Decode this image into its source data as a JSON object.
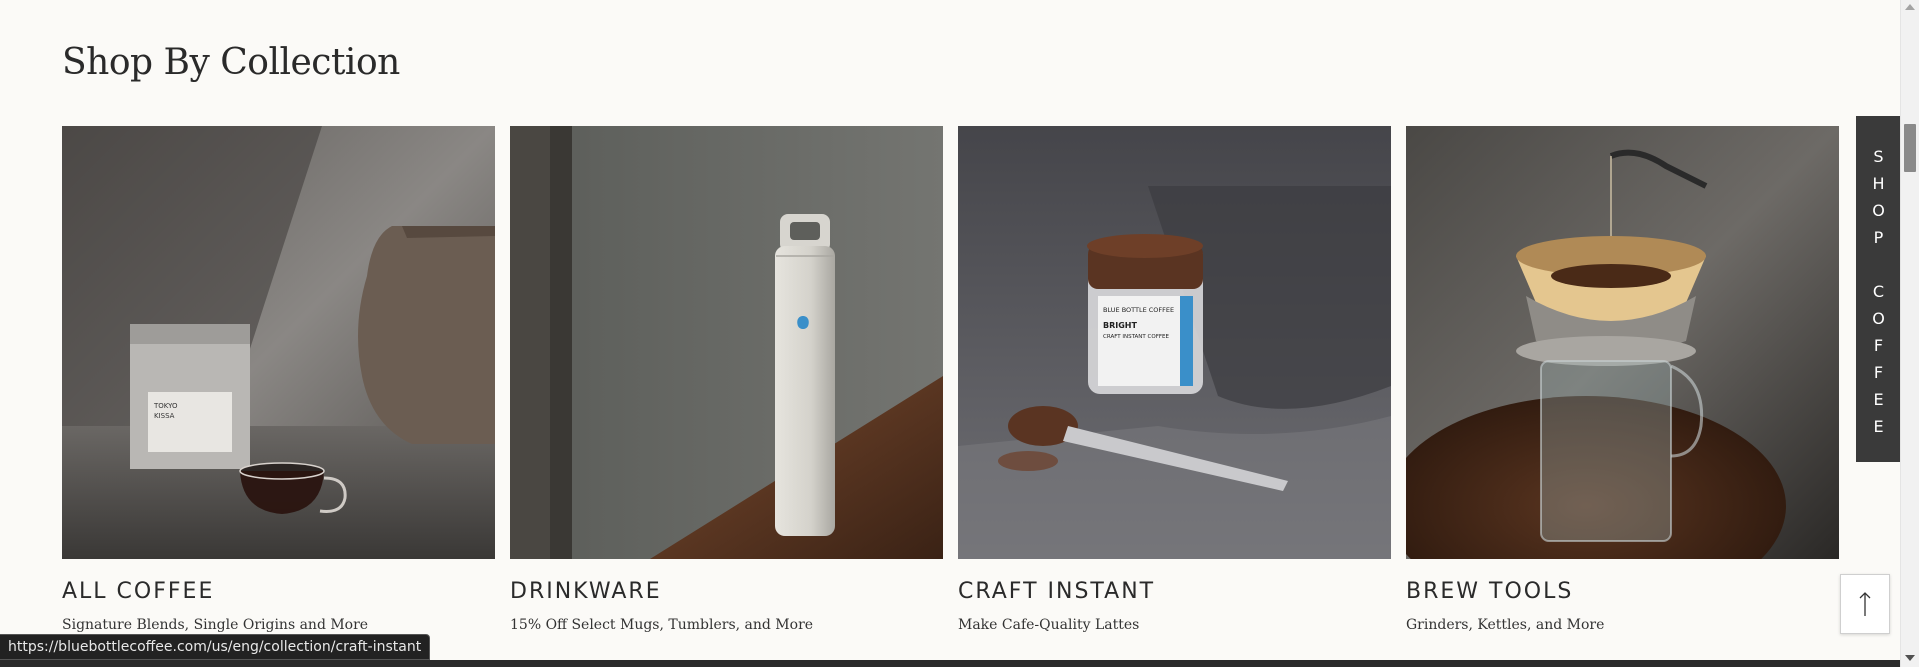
{
  "section": {
    "title": "Shop By Collection"
  },
  "collections": [
    {
      "title": "ALL COFFEE",
      "subtitle": "Signature Blends, Single Origins and More"
    },
    {
      "title": "DRINKWARE",
      "subtitle": "15% Off Select Mugs, Tumblers, and More"
    },
    {
      "title": "CRAFT INSTANT",
      "subtitle": "Make Cafe-Quality Lattes"
    },
    {
      "title": "BREW TOOLS",
      "subtitle": "Grinders, Kettles, and More"
    }
  ],
  "side_tab": {
    "letters": [
      "S",
      "H",
      "O",
      "P",
      "",
      "C",
      "O",
      "F",
      "F",
      "E",
      "E"
    ]
  },
  "scroll_top": {
    "icon": "arrow-up-icon"
  },
  "status_bar": {
    "url": "https://bluebottlecoffee.com/us/eng/collection/craft-instant"
  },
  "image_text": {
    "bag_line_1": "TOKYO",
    "bag_line_2": "KISSA",
    "jar_brand": "BLUE BOTTLE COFFEE",
    "jar_name": "BRIGHT",
    "jar_type": "CRAFT INSTANT COFFEE"
  },
  "colors": {
    "background": "#fbfaf7",
    "side_tab": "#3a3a3a",
    "brand_blue": "#3a8fc9"
  }
}
